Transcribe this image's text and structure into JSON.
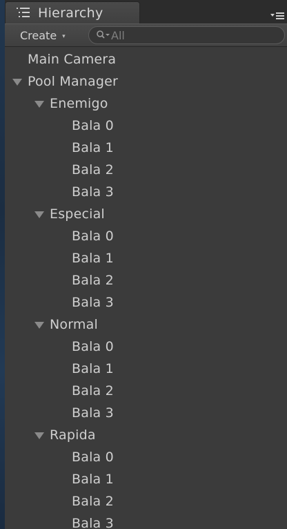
{
  "window": {
    "tab_title": "Hierarchy"
  },
  "toolbar": {
    "create_label": "Create",
    "create_arrow": "▾",
    "search_placeholder": "All"
  },
  "tree": [
    {
      "label": "Main Camera",
      "depth": 0,
      "expandable": false
    },
    {
      "label": "Pool Manager",
      "depth": 0,
      "expandable": true,
      "expanded": true
    },
    {
      "label": "Enemigo",
      "depth": 1,
      "expandable": true,
      "expanded": true
    },
    {
      "label": "Bala 0",
      "depth": 2,
      "expandable": false
    },
    {
      "label": "Bala 1",
      "depth": 2,
      "expandable": false
    },
    {
      "label": "Bala 2",
      "depth": 2,
      "expandable": false
    },
    {
      "label": "Bala 3",
      "depth": 2,
      "expandable": false
    },
    {
      "label": "Especial",
      "depth": 1,
      "expandable": true,
      "expanded": true
    },
    {
      "label": "Bala 0",
      "depth": 2,
      "expandable": false
    },
    {
      "label": "Bala 1",
      "depth": 2,
      "expandable": false
    },
    {
      "label": "Bala 2",
      "depth": 2,
      "expandable": false
    },
    {
      "label": "Bala 3",
      "depth": 2,
      "expandable": false
    },
    {
      "label": "Normal",
      "depth": 1,
      "expandable": true,
      "expanded": true
    },
    {
      "label": "Bala 0",
      "depth": 2,
      "expandable": false
    },
    {
      "label": "Bala 1",
      "depth": 2,
      "expandable": false
    },
    {
      "label": "Bala 2",
      "depth": 2,
      "expandable": false
    },
    {
      "label": "Bala 3",
      "depth": 2,
      "expandable": false
    },
    {
      "label": "Rapida",
      "depth": 1,
      "expandable": true,
      "expanded": true
    },
    {
      "label": "Bala 0",
      "depth": 2,
      "expandable": false
    },
    {
      "label": "Bala 1",
      "depth": 2,
      "expandable": false
    },
    {
      "label": "Bala 2",
      "depth": 2,
      "expandable": false
    },
    {
      "label": "Bala 3",
      "depth": 2,
      "expandable": false
    }
  ],
  "icons": {
    "tab": "hierarchy-list-icon",
    "menu": "panel-menu-icon",
    "search": "search-icon",
    "fold": "fold-triangle-icon"
  },
  "colors": {
    "panel_bg": "#3b3b3b",
    "text": "#cfcfcf",
    "fold_triangle": "#8a8a8a"
  }
}
